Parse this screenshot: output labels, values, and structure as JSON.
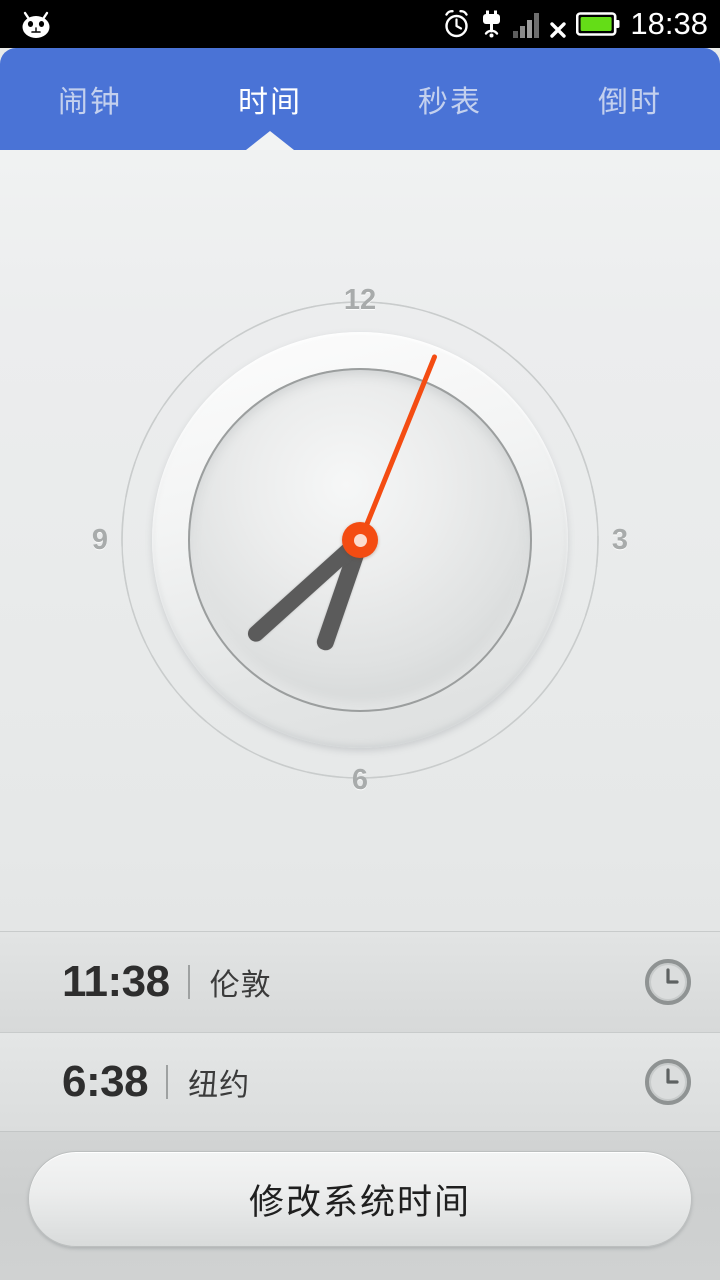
{
  "status_bar": {
    "notification_icon": "android-robot-icon",
    "icons": [
      "alarm-clock-icon",
      "usb-debugging-icon",
      "signal-bars-icon",
      "no-sim-x-icon",
      "battery-full-icon"
    ],
    "clock": "18:38",
    "background_color": "#000000"
  },
  "tabbar": {
    "background_color": "#4a73d6",
    "active_color": "#ffffff",
    "inactive_color": "#c3d0ee",
    "active_index": 1,
    "tabs": [
      {
        "label": "闹钟",
        "name": "tab-alarm"
      },
      {
        "label": "时间",
        "name": "tab-time"
      },
      {
        "label": "秒表",
        "name": "tab-stopwatch"
      },
      {
        "label": "倒时",
        "name": "tab-countdown"
      }
    ]
  },
  "clock": {
    "ring_numbers": {
      "twelve": "12",
      "three": "3",
      "six": "6",
      "nine": "9"
    },
    "time": "18:38",
    "hour_angle_deg": 199,
    "minute_angle_deg": 228,
    "second_angle_deg": 22,
    "second_hand_color": "#f44c12",
    "hand_color": "#5b5b5b",
    "numeral_color": "#a8abab"
  },
  "world_clocks": [
    {
      "time": "11:38",
      "city": "伦敦",
      "icon": "clock-icon"
    },
    {
      "time": "6:38",
      "city": "纽约",
      "icon": "clock-icon"
    }
  ],
  "footer": {
    "button_label": "修改系统时间"
  }
}
